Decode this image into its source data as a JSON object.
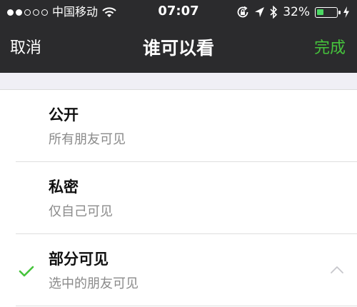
{
  "status_bar": {
    "carrier": "中国移动",
    "time": "07:07",
    "battery_percent": "32%",
    "battery_level": 0.32,
    "signal_bars_filled": 2,
    "signal_bars_total": 5,
    "icons": [
      "wifi-icon",
      "rotation-lock-icon",
      "location-arrow-icon",
      "bluetooth-icon",
      "battery-icon",
      "charging-bolt-icon"
    ]
  },
  "nav": {
    "cancel_label": "取消",
    "title": "谁可以看",
    "done_label": "完成"
  },
  "options": [
    {
      "label": "公开",
      "description": "所有朋友可见",
      "selected": false
    },
    {
      "label": "私密",
      "description": "仅自己可见",
      "selected": false
    },
    {
      "label": "部分可见",
      "description": "选中的朋友可见",
      "selected": true,
      "expanded": true
    }
  ],
  "colors": {
    "nav_background": "#2b2b2d",
    "accent_green": "#46c43c",
    "battery_green": "#4cd964",
    "page_background": "#f0eff5"
  }
}
